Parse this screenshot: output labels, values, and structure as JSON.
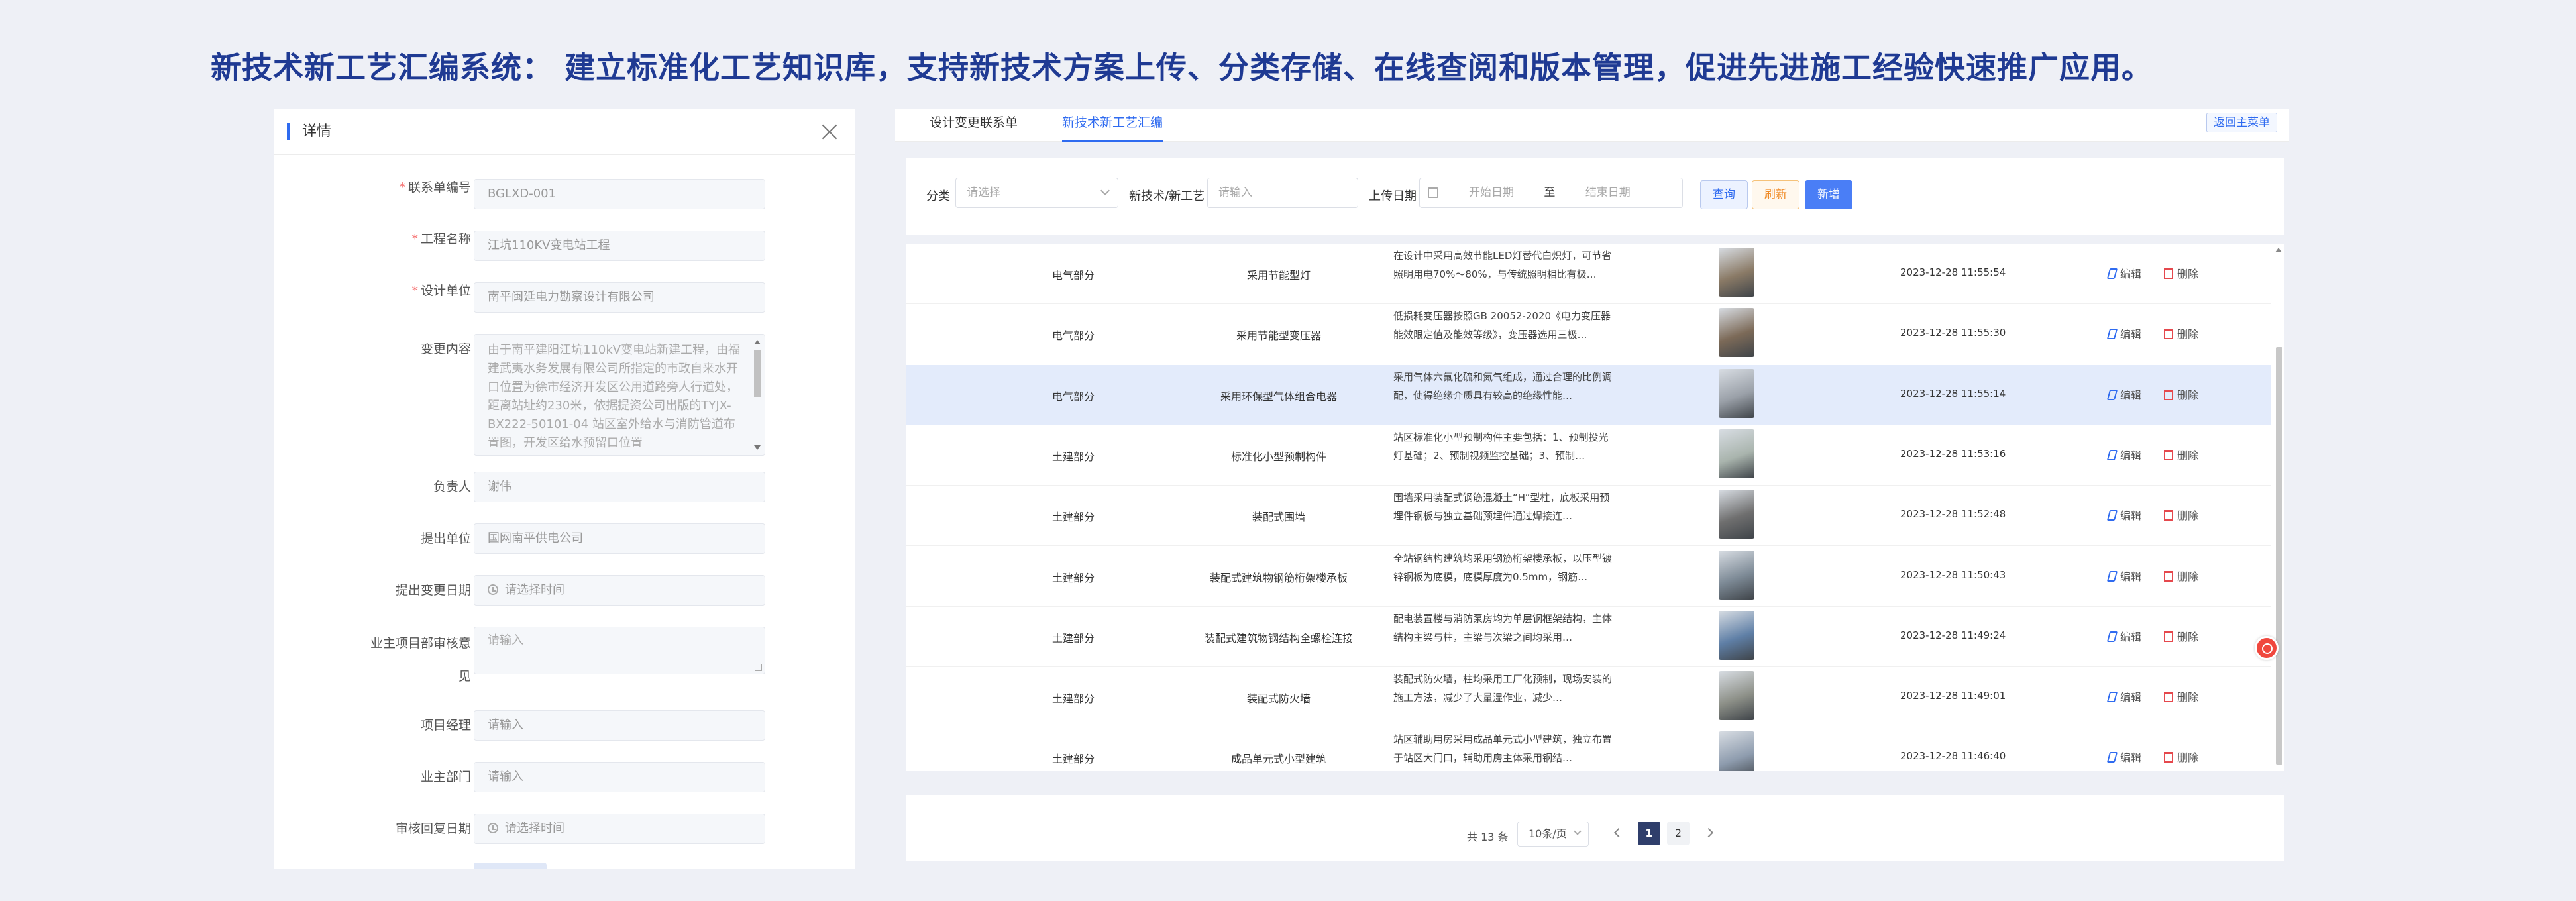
{
  "banner": {
    "text": "新技术新工艺汇编系统： 建立标准化工艺知识库，支持新技术方案上传、分类存储、在线查阅和版本管理，促进先进施工经验快速推广应用。"
  },
  "detail": {
    "title": "详情",
    "fields": [
      {
        "label": "联系单编号",
        "required": true,
        "value": "BGLXD-001"
      },
      {
        "label": "工程名称",
        "required": true,
        "value": "江坑110KV变电站工程"
      },
      {
        "label": "设计单位",
        "required": true,
        "value": "南平闽延电力勘察设计有限公司"
      },
      {
        "label": "变更内容",
        "required": false,
        "value": "由于南平建阳江坑110kV变电站新建工程，由福建武夷水务发展有限公司所指定的市政自来水开口位置为徐市经济开发区公用道路旁人行道处，距离站址约230米，依据提资公司出版的TYJX-BX222-50101-04 站区室外给水与消防管道布置图，开发区给水预留口位置"
      },
      {
        "label": "负责人",
        "required": false,
        "value": "谢伟"
      },
      {
        "label": "提出单位",
        "required": false,
        "value": "国网南平供电公司"
      },
      {
        "label": "提出变更日期",
        "required": false,
        "value": "请选择时间"
      },
      {
        "label": "业主项目部审核意见",
        "required": false,
        "value": "请输入"
      },
      {
        "label": "项目经理",
        "required": false,
        "value": "请输入"
      },
      {
        "label": "业主部门",
        "required": false,
        "value": "请输入"
      },
      {
        "label": "审核回复日期",
        "required": false,
        "value": "请选择时间"
      }
    ]
  },
  "tabs": [
    {
      "label": "设计变更联系单",
      "active": false
    },
    {
      "label": "新技术新工艺汇编",
      "active": true
    }
  ],
  "back_label": "返回主菜单",
  "filter": {
    "category_label": "分类",
    "category_placeholder": "请选择",
    "tech_label": "新技术/新工艺",
    "tech_placeholder": "请输入",
    "date_label": "上传日期",
    "start_placeholder": "开始日期",
    "range_sep": "至",
    "end_placeholder": "结束日期",
    "query_label": "查询",
    "reset_label": "刷新",
    "add_label": "新增"
  },
  "rows": [
    {
      "category": "电气部分",
      "name": "采用节能型灯",
      "desc": "在设计中采用高效节能LED灯替代白炽灯，可节省照明用电70%～80%，与传统照明相比有极…",
      "time": "2023-12-28 11:55:54",
      "img_color": "#8a7a66",
      "highlight": false
    },
    {
      "category": "电气部分",
      "name": "采用节能型变压器",
      "desc": "低损耗变压器按照GB 20052-2020《电力变压器能效限定值及能效等级》，变压器选用三极…",
      "time": "2023-12-28 11:55:30",
      "img_color": "#7c6a58",
      "highlight": false
    },
    {
      "category": "电气部分",
      "name": "采用环保型气体组合电器",
      "desc": "采用气体六氟化硫和氮气组成，通过合理的比例调配，使得绝缘介质具有较高的绝缘性能…",
      "time": "2023-12-28 11:55:14",
      "img_color": "#9aa0a8",
      "highlight": true
    },
    {
      "category": "土建部分",
      "name": "标准化小型预制构件",
      "desc": "站区标准化小型预制构件主要包括：1、预制投光灯基础；2、预制视频监控基础；3、预制…",
      "time": "2023-12-28 11:53:16",
      "img_color": "#a9b4ad",
      "highlight": false
    },
    {
      "category": "土建部分",
      "name": "装配式围墙",
      "desc": "围墙采用装配式钢筋混凝土“H”型柱，底板采用预埋件钢板与独立基础预埋件通过焊接连…",
      "time": "2023-12-28 11:52:48",
      "img_color": "#6f6f6f",
      "highlight": false
    },
    {
      "category": "土建部分",
      "name": "装配式建筑物钢筋桁架楼承板",
      "desc": "全站钢结构建筑均采用钢筋桁架楼承板，以压型镀锌钢板为底模，底模厚度为0.5mm，钢筋…",
      "time": "2023-12-28 11:50:43",
      "img_color": "#7d8a96",
      "highlight": false
    },
    {
      "category": "土建部分",
      "name": "装配式建筑物钢结构全螺栓连接",
      "desc": "配电装置楼与消防泵房均为单层钢框架结构，主体结构主梁与柱，主梁与次梁之间均采用…",
      "time": "2023-12-28 11:49:24",
      "img_color": "#5f7fa6",
      "highlight": false
    },
    {
      "category": "土建部分",
      "name": "装配式防火墙",
      "desc": "装配式防火墙，柱均采用工厂化预制，现场安装的施工方法，减少了大量湿作业，减少…",
      "time": "2023-12-28 11:49:01",
      "img_color": "#8d9088",
      "highlight": false
    },
    {
      "category": "土建部分",
      "name": "成品单元式小型建筑",
      "desc": "站区辅助用房采用成品单元式小型建筑，独立布置于站区大门口，辅助用房主体采用钢结…",
      "time": "2023-12-28 11:46:40",
      "img_color": "#8e9cae",
      "highlight": false
    }
  ],
  "actions": {
    "edit": "编辑",
    "delete": "删除"
  },
  "pager": {
    "total": "共 13 条",
    "page_size": "10条/页",
    "pages": [
      "1",
      "2"
    ],
    "current": "1"
  },
  "colors": {
    "accent": "#2f6bf0",
    "banner": "#1f3a93",
    "danger": "#e5484d"
  }
}
